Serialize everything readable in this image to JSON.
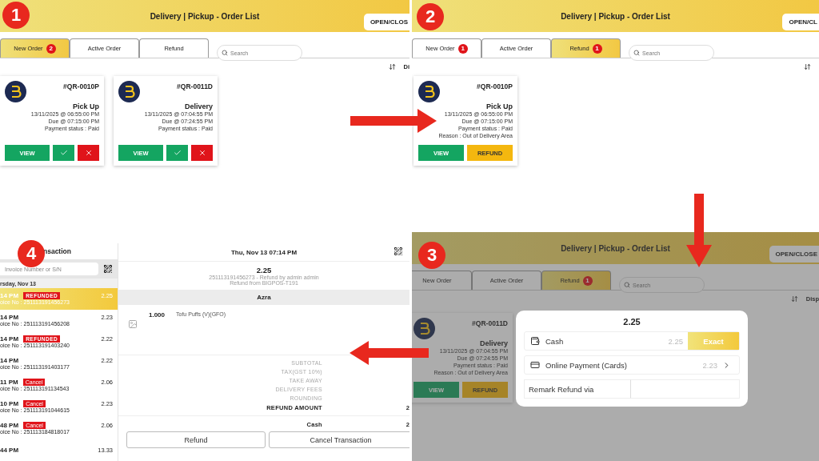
{
  "panels": [
    {
      "kind": "order_list",
      "step": "1",
      "title": "Delivery | Pickup - Order List",
      "open_close": "OPEN/CLOS",
      "tabs": [
        {
          "label": "New Order",
          "badge": "2",
          "selected": true
        },
        {
          "label": "Active Order",
          "selected": false
        },
        {
          "label": "Refund",
          "selected": false
        }
      ],
      "search": {
        "placeholder": "Search"
      },
      "sort_label": "Di",
      "cards": [
        {
          "order_no": "#QR-0010P",
          "type": "Pick Up",
          "created": "13/11/2025 @ 06:55:00 PM",
          "due": "Due @ 07:15:00 PM",
          "payment": "Payment status : Paid",
          "buttons": [
            {
              "kind": "view",
              "label": "VIEW"
            },
            {
              "kind": "accept"
            },
            {
              "kind": "reject"
            }
          ]
        },
        {
          "order_no": "#QR-0011D",
          "type": "Delivery",
          "created": "13/11/2025 @ 07:04:55 PM",
          "due": "Due @ 07:24:55 PM",
          "payment": "Payment status : Paid",
          "buttons": [
            {
              "kind": "view",
              "label": "VIEW"
            },
            {
              "kind": "accept"
            },
            {
              "kind": "reject"
            }
          ]
        }
      ]
    },
    {
      "kind": "order_list",
      "step": "2",
      "title": "Delivery | Pickup - Order List",
      "open_close": "OPEN/CL",
      "tabs": [
        {
          "label": "New Order",
          "badge": "1",
          "selected": false
        },
        {
          "label": "Active Order",
          "selected": false
        },
        {
          "label": "Refund",
          "badge": "1",
          "selected": true
        }
      ],
      "search": {
        "placeholder": "Search"
      },
      "cards": [
        {
          "order_no": "#QR-0010P",
          "type": "Pick Up",
          "created": "13/11/2025 @ 06:55:00 PM",
          "due": "Due @ 07:15:00 PM",
          "payment": "Payment status : Paid",
          "reason": "Reason : Out of Delivery Area",
          "buttons": [
            {
              "kind": "view",
              "label": "VIEW"
            },
            {
              "kind": "refund",
              "label": "REFUND"
            }
          ]
        }
      ]
    },
    {
      "kind": "transaction",
      "step": "4",
      "title": "nsaction",
      "search": {
        "placeholder": "Invoice Number or S/N"
      },
      "date_header": "rsday, Nov 13",
      "rows": [
        {
          "time": "14 PM",
          "tag": {
            "kind": "refunded",
            "label": "REFUNDED"
          },
          "amount": "2.25",
          "invoice": "oice No : 251113191456273",
          "selected": true
        },
        {
          "time": "14 PM",
          "amount": "2.23",
          "invoice": "oice No : 251113191456208",
          "selected": false
        },
        {
          "time": "14 PM",
          "tag": {
            "kind": "refunded",
            "label": "REFUNDED"
          },
          "amount": "2.22",
          "invoice": "oice No : 251113191403240",
          "selected": false
        },
        {
          "time": "14 PM",
          "amount": "2.22",
          "invoice": "oice No : 251113191403177",
          "selected": false
        },
        {
          "time": "11 PM",
          "tag": {
            "kind": "cancel",
            "label": "Cancel"
          },
          "amount": "2.06",
          "invoice": "oice No : 251113191134543",
          "selected": false
        },
        {
          "time": "10 PM",
          "tag": {
            "kind": "cancel",
            "label": "Cancel"
          },
          "amount": "2.23",
          "invoice": "oice No : 251113191044615",
          "selected": false
        },
        {
          "time": "48 PM",
          "tag": {
            "kind": "cancel",
            "label": "Cancel"
          },
          "amount": "2.06",
          "invoice": "oice No : 251113184818017",
          "selected": false
        },
        {
          "time": "44 PM",
          "amount": "13.33",
          "selected": false
        }
      ],
      "detail": {
        "datetime": "Thu, Nov 13 07:14 PM",
        "amount": "2.25",
        "lines": [
          "251113191456273 - Refund by admin admin",
          "Refund from BIGPOS-T191"
        ],
        "customer": "Azra",
        "items": [
          {
            "qty": "1.000",
            "name": "Tofu Puffs (V)(GFO)"
          }
        ],
        "summary": [
          {
            "label": "SUBTOTAL",
            "bold": false
          },
          {
            "label": "TAX(GST 10%)",
            "bold": false
          },
          {
            "label": "TAKE AWAY",
            "bold": false
          },
          {
            "label": "DELIVERY FEES",
            "bold": false
          },
          {
            "label": "ROUNDING",
            "bold": false
          },
          {
            "label": "REFUND AMOUNT",
            "value": "2",
            "bold": true
          }
        ],
        "payment": {
          "label": "Cash",
          "value": "2"
        },
        "buttons": [
          "Refund",
          "Cancel Transaction"
        ]
      }
    },
    {
      "kind": "order_list",
      "step": "3",
      "title": "Delivery | Pickup - Order List",
      "open_close": "OPEN/CLOSE",
      "tabs": [
        {
          "label": "New Order",
          "selected": false
        },
        {
          "label": "Active Order",
          "selected": false
        },
        {
          "label": "Refund",
          "badge": "1",
          "selected": true
        }
      ],
      "search": {
        "placeholder": "Search"
      },
      "sort_label": "Disp",
      "cards": [
        {
          "order_no": "#QR-0011D",
          "type": "Delivery",
          "created": "13/11/2025 @ 07:04:55 PM",
          "due": "Due @ 07:24:55 PM",
          "payment": "Payment status : Paid",
          "reason": "Reason : Out of Delivery Area",
          "buttons": [
            {
              "kind": "view",
              "label": "VIEW"
            },
            {
              "kind": "refund",
              "label": "REFUND"
            }
          ]
        }
      ],
      "modal": {
        "amount": "2.25",
        "methods": [
          {
            "kind": "cash",
            "label": "Cash",
            "amount": "2.25",
            "action": "Exact"
          },
          {
            "kind": "card",
            "label": "Online Payment (Cards)",
            "amount": "2.23"
          }
        ],
        "remark_label": "Remark Refund via"
      }
    }
  ]
}
